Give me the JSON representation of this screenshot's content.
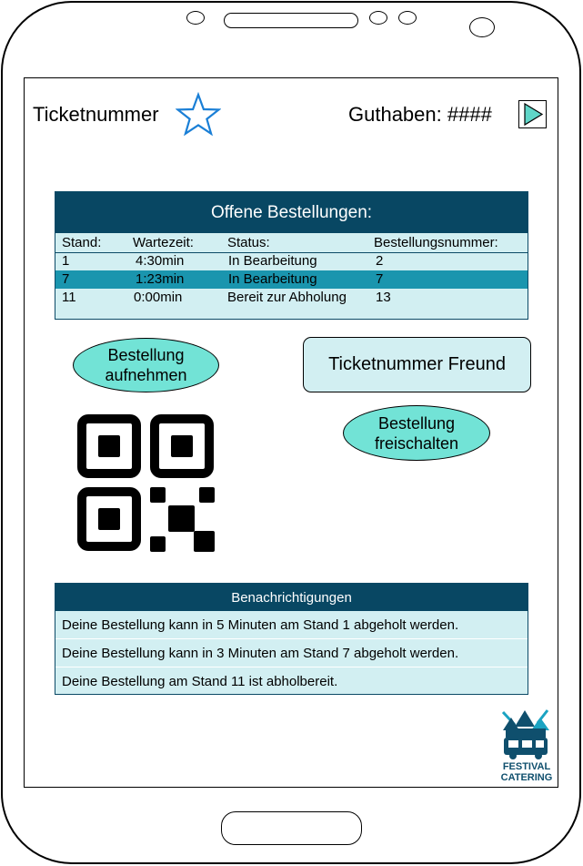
{
  "header": {
    "ticket_label": "Ticketnummer",
    "balance_label": "Guthaben: ####"
  },
  "orders": {
    "title": "Offene Bestellungen:",
    "columns": [
      "Stand:",
      "Wartezeit:",
      "Status:",
      "Bestellungsnummer:"
    ],
    "rows": [
      [
        "1",
        "4:30min",
        "In Bearbeitung",
        "2"
      ],
      [
        "7",
        "1:23min",
        "In Bearbeitung",
        "7"
      ],
      [
        "11",
        "0:00min",
        "Bereit zur Abholung",
        "13"
      ]
    ]
  },
  "actions": {
    "place_order": "Bestellung aufnehmen",
    "friend_ticket": "Ticketnummer Freund",
    "unlock_order": "Bestellung freischalten"
  },
  "notifications": {
    "title": "Benachrichtigungen",
    "items": [
      "Deine Bestellung kann in 5 Minuten am Stand 1 abgeholt werden.",
      "Deine Bestellung kann in 3 Minuten am Stand 7 abgeholt werden.",
      "Deine Bestellung am Stand 11 ist abholbereit."
    ]
  },
  "logo": {
    "line1": "FESTIVAL",
    "line2": "CATERING"
  },
  "colors": {
    "header_bg": "#084763",
    "table_bg": "#d2eff2",
    "highlight_row": "#1a95ae",
    "ellipse_button": "#72e3d6",
    "star_outline": "#1a7fd6"
  },
  "icons": [
    "star-icon",
    "play-icon",
    "qr-code-icon",
    "festival-catering-logo"
  ]
}
